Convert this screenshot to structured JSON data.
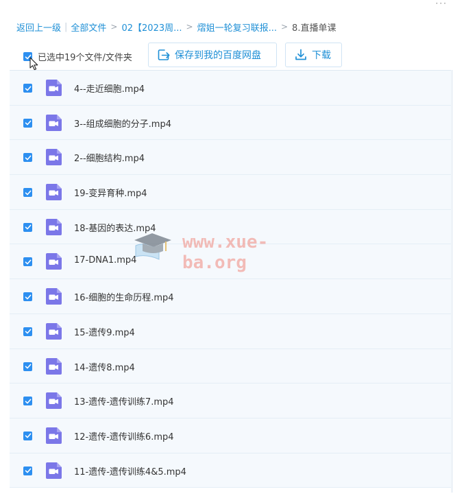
{
  "breadcrumb": {
    "back": "返回上一级",
    "items": [
      "全部文件",
      "02【2023周...",
      "熠姐一轮复习联报...",
      "8.直播单课"
    ]
  },
  "toolbar": {
    "selection_text": "已选中19个文件/文件夹",
    "save_label": "保存到我的百度网盘",
    "download_label": "下载"
  },
  "files": [
    "4--走近细胞.mp4",
    "3--组成细胞的分子.mp4",
    "2--细胞结构.mp4",
    "19-变异育种.mp4",
    "18-基因的表达.mp4",
    "17-DNA1.mp4",
    "16-细胞的生命历程.mp4",
    "15-遗传9.mp4",
    "14-遗传8.mp4",
    "13-遗传-遗传训练7.mp4",
    "12-遗传-遗传训练6.mp4",
    "11-遗传-遗传训练4&5.mp4"
  ],
  "watermark": {
    "text": "www.xue-ba.org"
  },
  "colors": {
    "accent": "#1e8fd6",
    "checkbox": "#2d8ff0",
    "video_icon": "#7b77e8",
    "row_bg": "#f5f9fd"
  },
  "icons": {
    "file": "video-file-icon",
    "save": "save-to-cloud-icon",
    "download": "download-icon"
  }
}
